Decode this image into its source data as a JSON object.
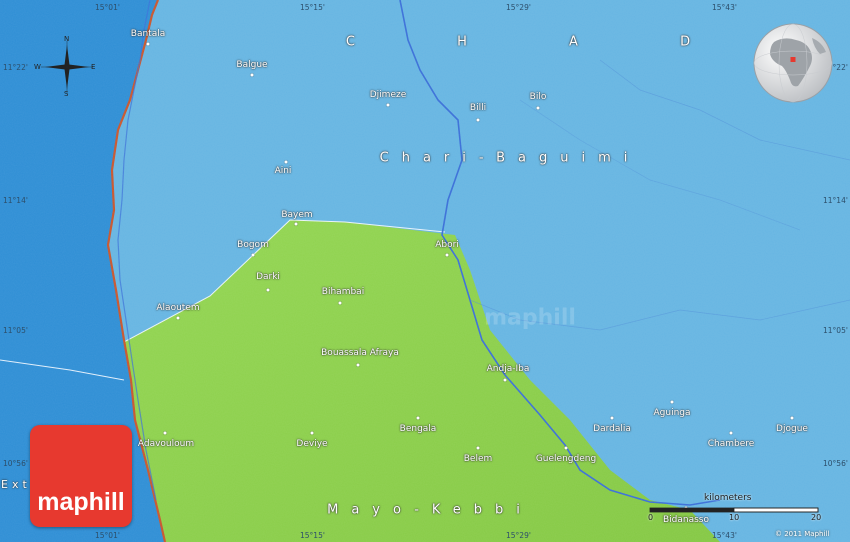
{
  "colors": {
    "water": "#65b4e2",
    "sea": "#2e8fd6",
    "land_highlight": "#8ed14c",
    "river": "#3a6fd8",
    "border": "#c8562e",
    "logo": "#e7392f"
  },
  "country_label": "C H A D",
  "regions": {
    "chari_baguimi": "Chari-Baguimi",
    "mayo_kebbi": "Mayo-Kebbi",
    "extreme_nord": "Ext"
  },
  "places": [
    {
      "name": "Bantala"
    },
    {
      "name": "Balgue"
    },
    {
      "name": "Djimeze"
    },
    {
      "name": "Billi"
    },
    {
      "name": "Bilo"
    },
    {
      "name": "Aini"
    },
    {
      "name": "Bayem"
    },
    {
      "name": "Bogom"
    },
    {
      "name": "Abori"
    },
    {
      "name": "Darki"
    },
    {
      "name": "Bihambai"
    },
    {
      "name": "Alaoutem"
    },
    {
      "name": "Bouassala Afraya"
    },
    {
      "name": "Andja-Iba"
    },
    {
      "name": "Bengala"
    },
    {
      "name": "Adavouloum"
    },
    {
      "name": "Deviye"
    },
    {
      "name": "Belem"
    },
    {
      "name": "Guelengdeng"
    },
    {
      "name": "Dardalia"
    },
    {
      "name": "Aguinga"
    },
    {
      "name": "Chambere"
    },
    {
      "name": "Djogue"
    },
    {
      "name": "Bidanasso"
    }
  ],
  "coordinates": {
    "top": [
      "15°01'",
      "15°15'",
      "15°29'",
      "15°43'"
    ],
    "bottom": [
      "15°01'",
      "15°15'",
      "15°29'",
      "15°43'"
    ],
    "left": [
      "11°22'",
      "11°14'",
      "11°05'",
      "10°56'"
    ],
    "right": [
      "11°22'",
      "11°14'",
      "11°05'",
      "10°56'"
    ]
  },
  "compass": {
    "n": "N",
    "s": "S",
    "e": "E",
    "w": "W"
  },
  "scale": {
    "title": "kilometers",
    "ticks": [
      "0",
      "10",
      "20"
    ]
  },
  "logo_text": "maphill",
  "watermark": "maphill",
  "copyright": "© 2011 Maphill"
}
